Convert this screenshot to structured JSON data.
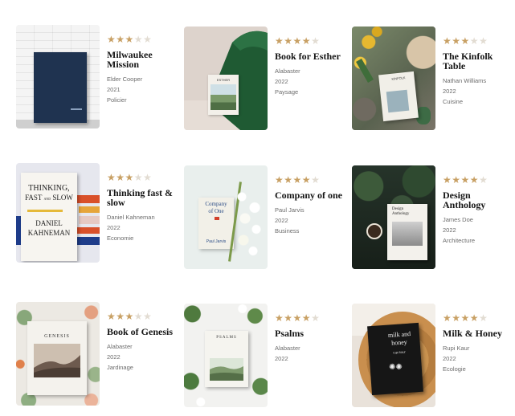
{
  "books": [
    {
      "title": "Milwaukee Mission",
      "author": "Elder Cooper",
      "year": "2021",
      "genre": "Policier",
      "rating": 3
    },
    {
      "title": "Book for Esther",
      "author": "Alabaster",
      "year": "2022",
      "genre": "Paysage",
      "rating": 4
    },
    {
      "title": "The Kinfolk Table",
      "author": "Nathan Williams",
      "year": "2022",
      "genre": "Cuisine",
      "rating": 3
    },
    {
      "title": "Thinking fast & slow",
      "author": "Daniel Kahneman",
      "year": "2022",
      "genre": "Economie",
      "rating": 3
    },
    {
      "title": "Company of one",
      "author": "Paul Jarvis",
      "year": "2022",
      "genre": "Business",
      "rating": 4
    },
    {
      "title": "Design Anthology",
      "author": "James Doe",
      "year": "2022",
      "genre": "Architecture",
      "rating": 4
    },
    {
      "title": "Book of Genesis",
      "author": "Alabaster",
      "year": "2022",
      "genre": "Jardinage",
      "rating": 3
    },
    {
      "title": "Psalms",
      "author": "Alabaster",
      "year": "2022",
      "genre": "Poésie",
      "rating": 4
    },
    {
      "title": "Milk & Honey",
      "author": "Rupi Kaur",
      "year": "2022",
      "genre": "Ecologie",
      "rating": 4
    }
  ],
  "covers": {
    "esther": "ESTHER",
    "kinfolk": "KINFOLK",
    "thinking_1": "THINKING,",
    "thinking_2": "FAST",
    "thinking_and": "AND",
    "thinking_3": "SLOW",
    "thinking_4": "DANIEL",
    "thinking_5": "KAHNEMAN",
    "company_1": "Company",
    "company_2": "of One",
    "company_3": "Paul Jarvis",
    "design_1": "Design",
    "design_2": "Anthology",
    "genesis": "GENESIS",
    "psalms": "PSALMS",
    "milk_1": "milk and",
    "milk_2": "honey",
    "milk_3": "rupi kaur"
  },
  "colors": {
    "star_on": "#c8a064",
    "star_off": "#e2dcd2"
  }
}
